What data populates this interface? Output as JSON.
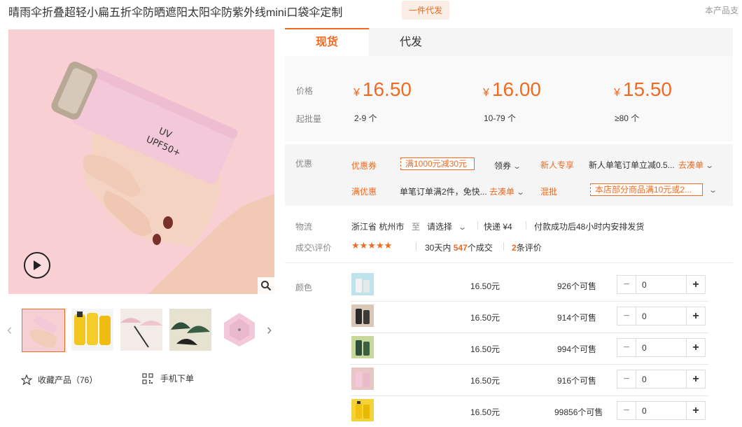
{
  "header": {
    "title": "晴雨伞折叠超轻小扁五折伞防晒遮阳太阳伞防紫外线mini口袋伞定制",
    "badge": "一件代发",
    "note": "本产品支"
  },
  "gallery": {
    "icons": [
      "play-icon",
      "zoom-icon",
      "chevron-left-icon",
      "chevron-right-icon"
    ],
    "thumbnails": [
      "thumb-pink-umbrella-hand",
      "thumb-yellow-umbrellas",
      "thumb-pink-open-umbrellas",
      "thumb-green-umbrellas",
      "thumb-pink-open-umbrella"
    ],
    "favorite_label": "收藏产品（76）",
    "mobile_label": "手机下单",
    "product_print": "UV\nUPF50+"
  },
  "tabs": [
    {
      "label": "现货",
      "active": true
    },
    {
      "label": "代发",
      "active": false
    }
  ],
  "pricing": {
    "price_label": "价格",
    "moq_label": "起批量",
    "currency": "¥",
    "tiers": [
      {
        "price": "16.50",
        "moq": "2-9 个"
      },
      {
        "price": "16.00",
        "moq": "10-79 个"
      },
      {
        "price": "15.50",
        "moq": "≥80 个"
      }
    ]
  },
  "promotions": {
    "label": "优惠",
    "coupon_label": "优惠券",
    "coupon_value": "满1000元减30元",
    "claim_label": "领券",
    "newbie_label": "新人专享",
    "newbie_text": "新人单笔订单立减0.5...",
    "newbie_link": "去凑单",
    "full_label": "满优惠",
    "full_text": "单笔订单满2件，免快...",
    "full_link": "去凑单",
    "mixed_label": "混批",
    "mixed_value": "本店部分商品满10元或2..."
  },
  "logistics": {
    "label": "物流",
    "from": "浙江省 杭州市",
    "to_word": "至",
    "destination": "请选择",
    "shipping": "快递 ¥4",
    "dispatch": "付款成功后48小时内安排发货"
  },
  "deals": {
    "label": "成交\\评价",
    "stars": "★★★★★",
    "period": "30天内",
    "count": "547",
    "count_suffix": "个成交",
    "reviews": "2",
    "reviews_suffix": "条评价"
  },
  "sku": {
    "label": "颜色",
    "colors": {
      "accent": "#f26a21"
    },
    "rows": [
      {
        "swatch": "light-blue",
        "price": "16.50元",
        "stock": "926个可售",
        "qty": "0"
      },
      {
        "swatch": "black",
        "price": "16.50元",
        "stock": "914个可售",
        "qty": "0"
      },
      {
        "swatch": "green",
        "price": "16.50元",
        "stock": "994个可售",
        "qty": "0"
      },
      {
        "swatch": "pink",
        "price": "16.50元",
        "stock": "916个可售",
        "qty": "0"
      },
      {
        "swatch": "yellow",
        "price": "16.50元",
        "stock": "99856个可售",
        "qty": "0"
      }
    ]
  }
}
